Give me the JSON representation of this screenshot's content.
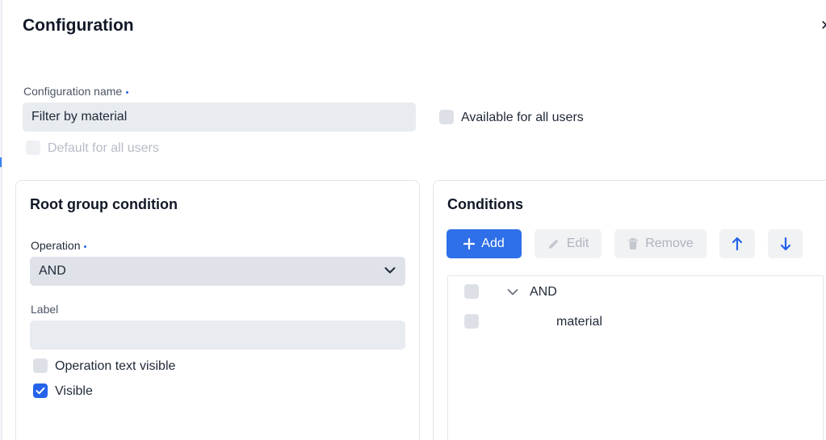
{
  "dialog": {
    "title": "Configuration",
    "close_icon": "close-icon"
  },
  "config": {
    "name_label": "Configuration name",
    "name_value": "Filter by material",
    "available_all_users": {
      "label": "Available for all users",
      "checked": false
    },
    "default_all_users": {
      "label": "Default for all users",
      "checked": false,
      "disabled": true
    }
  },
  "root_group": {
    "title": "Root group condition",
    "operation_label": "Operation",
    "operation_value": "AND",
    "label_label": "Label",
    "label_value": "",
    "operation_text_visible": {
      "label": "Operation text visible",
      "checked": false
    },
    "visible": {
      "label": "Visible",
      "checked": true
    }
  },
  "conditions": {
    "title": "Conditions",
    "toolbar": {
      "add_label": "Add",
      "edit_label": "Edit",
      "remove_label": "Remove",
      "up_icon": "arrow-up-icon",
      "down_icon": "arrow-down-icon"
    },
    "tree": [
      {
        "label": "AND",
        "expanded": true,
        "level": 0
      },
      {
        "label": "material",
        "level": 1
      }
    ]
  },
  "colors": {
    "accent": "#2f6fe8",
    "input_bg": "#e8ebf0",
    "disabled_text": "#aeb4bd"
  }
}
